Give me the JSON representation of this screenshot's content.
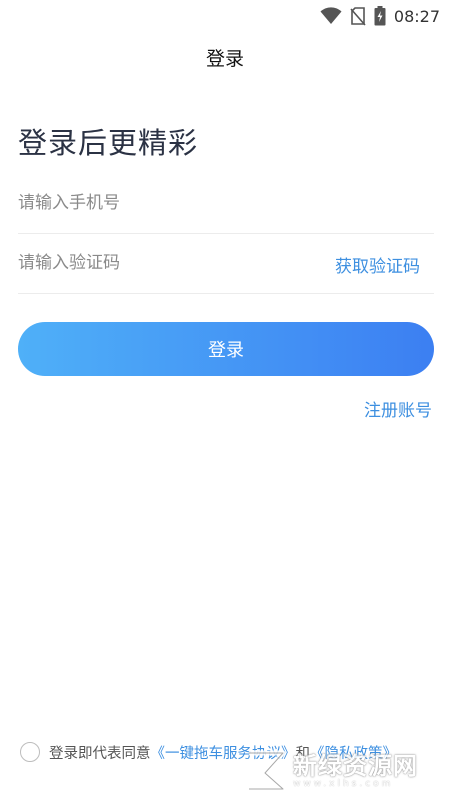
{
  "status_bar": {
    "time": "08:27",
    "icons": [
      "wifi-icon",
      "no-sim-icon",
      "battery-charging-icon"
    ]
  },
  "nav": {
    "title": "登录"
  },
  "headline": "登录后更精彩",
  "form": {
    "phone_placeholder": "请输入手机号",
    "code_placeholder": "请输入验证码",
    "get_code_label": "获取验证码",
    "login_label": "登录",
    "register_label": "注册账号"
  },
  "agreement": {
    "checked": false,
    "prefix": "登录即代表同意",
    "service_link": "《一键拖车服务协议》",
    "conjunction": "和",
    "privacy_link": "《隐私政策》"
  },
  "watermark": {
    "name": "新绿资源网",
    "url": "www.xlhs.com"
  },
  "colors": {
    "accent": "#3d8fe0",
    "button_start": "#4fb0f8",
    "button_end": "#3c7ff2"
  }
}
